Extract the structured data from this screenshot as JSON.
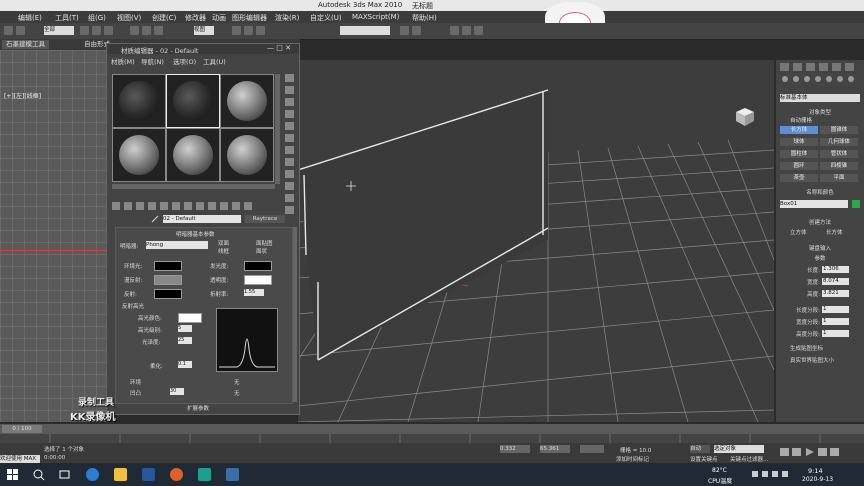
{
  "window": {
    "title": "Autodesk 3ds Max  2010",
    "file_name": "无标题"
  },
  "menu": [
    "编辑(E)",
    "工具(T)",
    "组(G)",
    "视图(V)",
    "创建(C)",
    "修改器",
    "动画",
    "图形编辑器",
    "渲染(R)",
    "自定义(U)",
    "MAXScript(M)",
    "帮助(H)"
  ],
  "ribbon": {
    "tabs": [
      "石墨建模工具",
      "自由形式"
    ]
  },
  "left_viewport": {
    "label": "[+][左][线框]"
  },
  "material_editor": {
    "title": "材质编辑器 - 02 - Default",
    "menu": [
      "材质(M)",
      "导航(N)",
      "选项(O)",
      "工具(U)"
    ],
    "material_name": "02 - Default",
    "material_type": "Raytrace",
    "rollout_basic": "明暗器基本参数",
    "shader_label": "明暗器:",
    "shader_value": "Phong",
    "opt_wire": "线框",
    "opt_two_sided": "双面",
    "opt_face_map": "面贴图",
    "opt_faceted": "面状",
    "ambient": "环境光:",
    "diffuse": "漫反射:",
    "specular": "反射:",
    "self_illum": "发光度:",
    "opacity": "透明度:",
    "refl_label": "折射率:",
    "refl_value": "1.55",
    "spec_group": "反射高光",
    "spec_color": "高光颜色:",
    "spec_level": "高光级别:",
    "spec_level_val": "5",
    "glossiness": "光泽度:",
    "glossiness_val": "25",
    "soften": "柔化:",
    "soften_val": "0.1",
    "env_label": "环境",
    "bump_label": "凹凸",
    "bump_val": "30",
    "none": "无",
    "rollout_ext": "扩展参数"
  },
  "right_panel": {
    "dropdown": "标准基本体",
    "object_type": "对象类型",
    "auto_grid": "自动栅格",
    "buttons": [
      "长方体",
      "圆锥体",
      "球体",
      "几何球体",
      "圆柱体",
      "管状体",
      "圆环",
      "四棱锥",
      "茶壶",
      "平面"
    ],
    "name_color": "名称和颜色",
    "object_name": "Box01",
    "creation_method": "创建方法",
    "cube": "立方体",
    "box": "长方体",
    "keyboard_entry": "键盘输入",
    "params": "参数",
    "length": "长度:",
    "length_val": "1.306",
    "width": "宽度:",
    "width_val": "8.074",
    "height": "高度:",
    "height_val": "3.821",
    "len_segs": "长度分段:",
    "len_segs_val": "1",
    "wid_segs": "宽度分段:",
    "wid_segs_val": "1",
    "hei_segs": "高度分段:",
    "hei_segs_val": "1",
    "gen_mapping": "生成贴图坐标",
    "real_world": "真实世界贴图大小"
  },
  "timeline": {
    "frame": "0 / 100"
  },
  "status": {
    "welcome": "欢迎使用 MAX",
    "selected": "选择了 1 个对象",
    "time": "0:00:00",
    "x_val": "0.332",
    "y_val": "65.361",
    "grid": "栅格 = 10.0",
    "auto_key": "自动",
    "selected_obj": "选定对象",
    "add_time_tag": "添加时间标记",
    "set_key": "设置关键点",
    "key_filter": "关键点过滤器..."
  },
  "taskbar": {
    "temp": "82°C",
    "cpu": "CPU温度",
    "clock": "9:14",
    "date": "2020-9-13"
  },
  "watermark": {
    "line1": "录制工具",
    "line2": "KK录像机"
  },
  "colors": {
    "accent": "#5b8fd6",
    "taskbar": "#1f2a36",
    "green_swatch": "#2aa84a"
  }
}
